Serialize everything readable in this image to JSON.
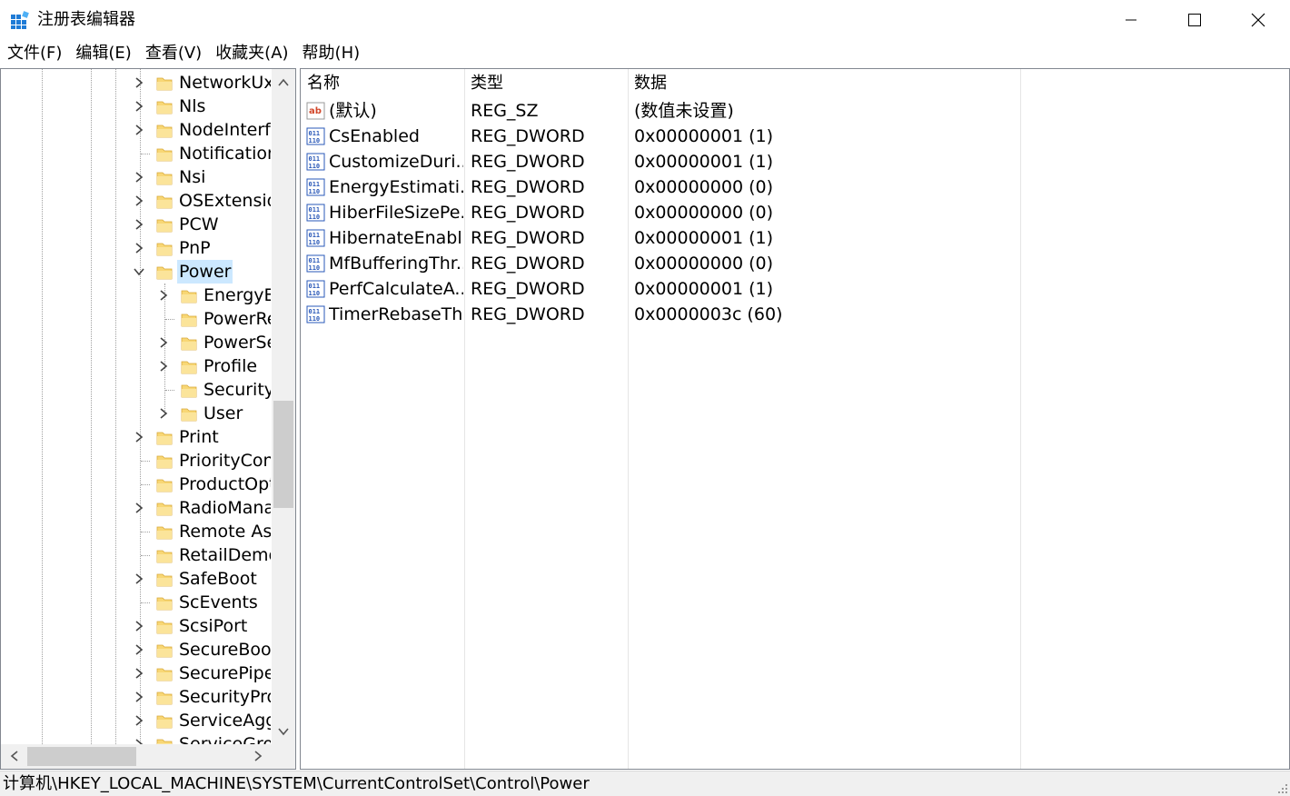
{
  "window": {
    "title": "注册表编辑器"
  },
  "menu": [
    "文件(F)",
    "编辑(E)",
    "查看(V)",
    "收藏夹(A)",
    "帮助(H)"
  ],
  "tree": {
    "items": [
      {
        "label": "NetworkUxl",
        "level": 1,
        "expander": "collapsed"
      },
      {
        "label": "Nls",
        "level": 1,
        "expander": "collapsed"
      },
      {
        "label": "NodeInterfa",
        "level": 1,
        "expander": "collapsed"
      },
      {
        "label": "Notification",
        "level": 1,
        "expander": "none"
      },
      {
        "label": "Nsi",
        "level": 1,
        "expander": "collapsed"
      },
      {
        "label": "OSExtension",
        "level": 1,
        "expander": "collapsed"
      },
      {
        "label": "PCW",
        "level": 1,
        "expander": "collapsed"
      },
      {
        "label": "PnP",
        "level": 1,
        "expander": "collapsed"
      },
      {
        "label": "Power",
        "level": 1,
        "expander": "expanded",
        "selected": true
      },
      {
        "label": "EnergyEs",
        "level": 2,
        "expander": "collapsed"
      },
      {
        "label": "PowerRe",
        "level": 2,
        "expander": "none"
      },
      {
        "label": "PowerSe",
        "level": 2,
        "expander": "collapsed"
      },
      {
        "label": "Profile",
        "level": 2,
        "expander": "collapsed"
      },
      {
        "label": "SecurityI",
        "level": 2,
        "expander": "none"
      },
      {
        "label": "User",
        "level": 2,
        "expander": "collapsed"
      },
      {
        "label": "Print",
        "level": 1,
        "expander": "collapsed"
      },
      {
        "label": "PriorityCont",
        "level": 1,
        "expander": "none"
      },
      {
        "label": "ProductOpt",
        "level": 1,
        "expander": "none"
      },
      {
        "label": "RadioMana",
        "level": 1,
        "expander": "collapsed"
      },
      {
        "label": "Remote Ass",
        "level": 1,
        "expander": "none"
      },
      {
        "label": "RetailDemo",
        "level": 1,
        "expander": "none"
      },
      {
        "label": "SafeBoot",
        "level": 1,
        "expander": "collapsed"
      },
      {
        "label": "ScEvents",
        "level": 1,
        "expander": "none"
      },
      {
        "label": "ScsiPort",
        "level": 1,
        "expander": "collapsed"
      },
      {
        "label": "SecureBoot",
        "level": 1,
        "expander": "collapsed"
      },
      {
        "label": "SecurePipeS",
        "level": 1,
        "expander": "collapsed"
      },
      {
        "label": "SecurityPro",
        "level": 1,
        "expander": "collapsed"
      },
      {
        "label": "ServiceAggr",
        "level": 1,
        "expander": "collapsed"
      },
      {
        "label": "ServiceGrou",
        "level": 1,
        "expander": "collapsed"
      }
    ]
  },
  "list": {
    "columns": [
      "名称",
      "类型",
      "数据"
    ],
    "rows": [
      {
        "icon": "string-value-icon",
        "name": "(默认)",
        "type": "REG_SZ",
        "data": "(数值未设置)"
      },
      {
        "icon": "binary-value-icon",
        "name": "CsEnabled",
        "type": "REG_DWORD",
        "data": "0x00000001 (1)"
      },
      {
        "icon": "binary-value-icon",
        "name": "CustomizeDuri...",
        "type": "REG_DWORD",
        "data": "0x00000001 (1)"
      },
      {
        "icon": "binary-value-icon",
        "name": "EnergyEstimati...",
        "type": "REG_DWORD",
        "data": "0x00000000 (0)"
      },
      {
        "icon": "binary-value-icon",
        "name": "HiberFileSizePe...",
        "type": "REG_DWORD",
        "data": "0x00000000 (0)"
      },
      {
        "icon": "binary-value-icon",
        "name": "HibernateEnabl...",
        "type": "REG_DWORD",
        "data": "0x00000001 (1)"
      },
      {
        "icon": "binary-value-icon",
        "name": "MfBufferingThr...",
        "type": "REG_DWORD",
        "data": "0x00000000 (0)"
      },
      {
        "icon": "binary-value-icon",
        "name": "PerfCalculateA...",
        "type": "REG_DWORD",
        "data": "0x00000001 (1)"
      },
      {
        "icon": "binary-value-icon",
        "name": "TimerRebaseTh...",
        "type": "REG_DWORD",
        "data": "0x0000003c (60)"
      }
    ]
  },
  "status": {
    "path": "计算机\\HKEY_LOCAL_MACHINE\\SYSTEM\\CurrentControlSet\\Control\\Power"
  },
  "colors": {
    "selection": "#cce8ff",
    "folder": "#f8d775",
    "scroll_thumb": "#cdcdcd"
  }
}
